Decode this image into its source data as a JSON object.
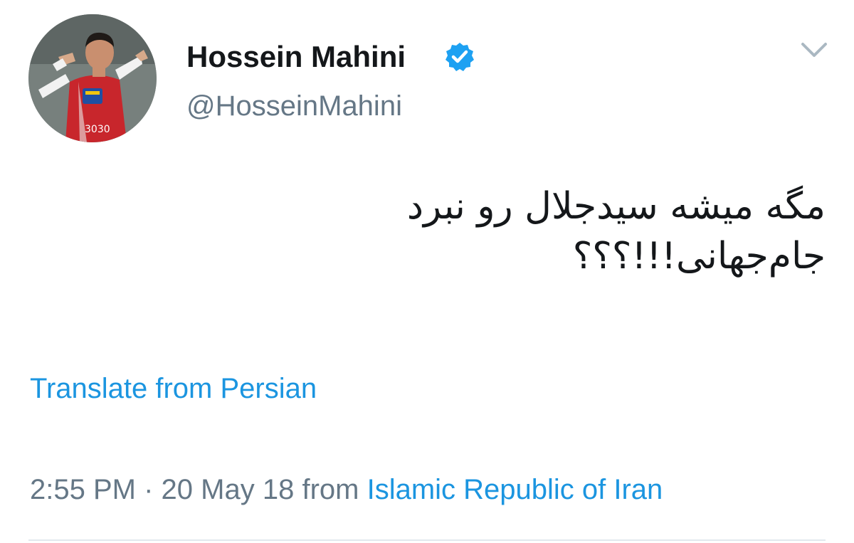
{
  "user": {
    "display_name": "Hossein Mahini",
    "handle": "@HosseinMahini",
    "verified": true,
    "avatar_icon": "avatar-photo",
    "avatar_jersey_text": "3030"
  },
  "tweet": {
    "lines": [
      "مگه میشه سیدجلال رو نبرد",
      "جام‌جهانی!!!؟؟؟"
    ],
    "translate_label": "Translate from Persian",
    "time": "2:55 PM",
    "separator": "·",
    "date": "20 May 18",
    "from_label": "from",
    "location": "Islamic Republic of Iran"
  },
  "icons": {
    "verified": "verified-badge-icon",
    "menu": "chevron-down-icon"
  },
  "colors": {
    "link": "#1b95e0",
    "secondary_text": "#657786",
    "primary_text": "#14171a",
    "verified_badge": "#1da1f2",
    "divider": "#e1e8ed"
  }
}
